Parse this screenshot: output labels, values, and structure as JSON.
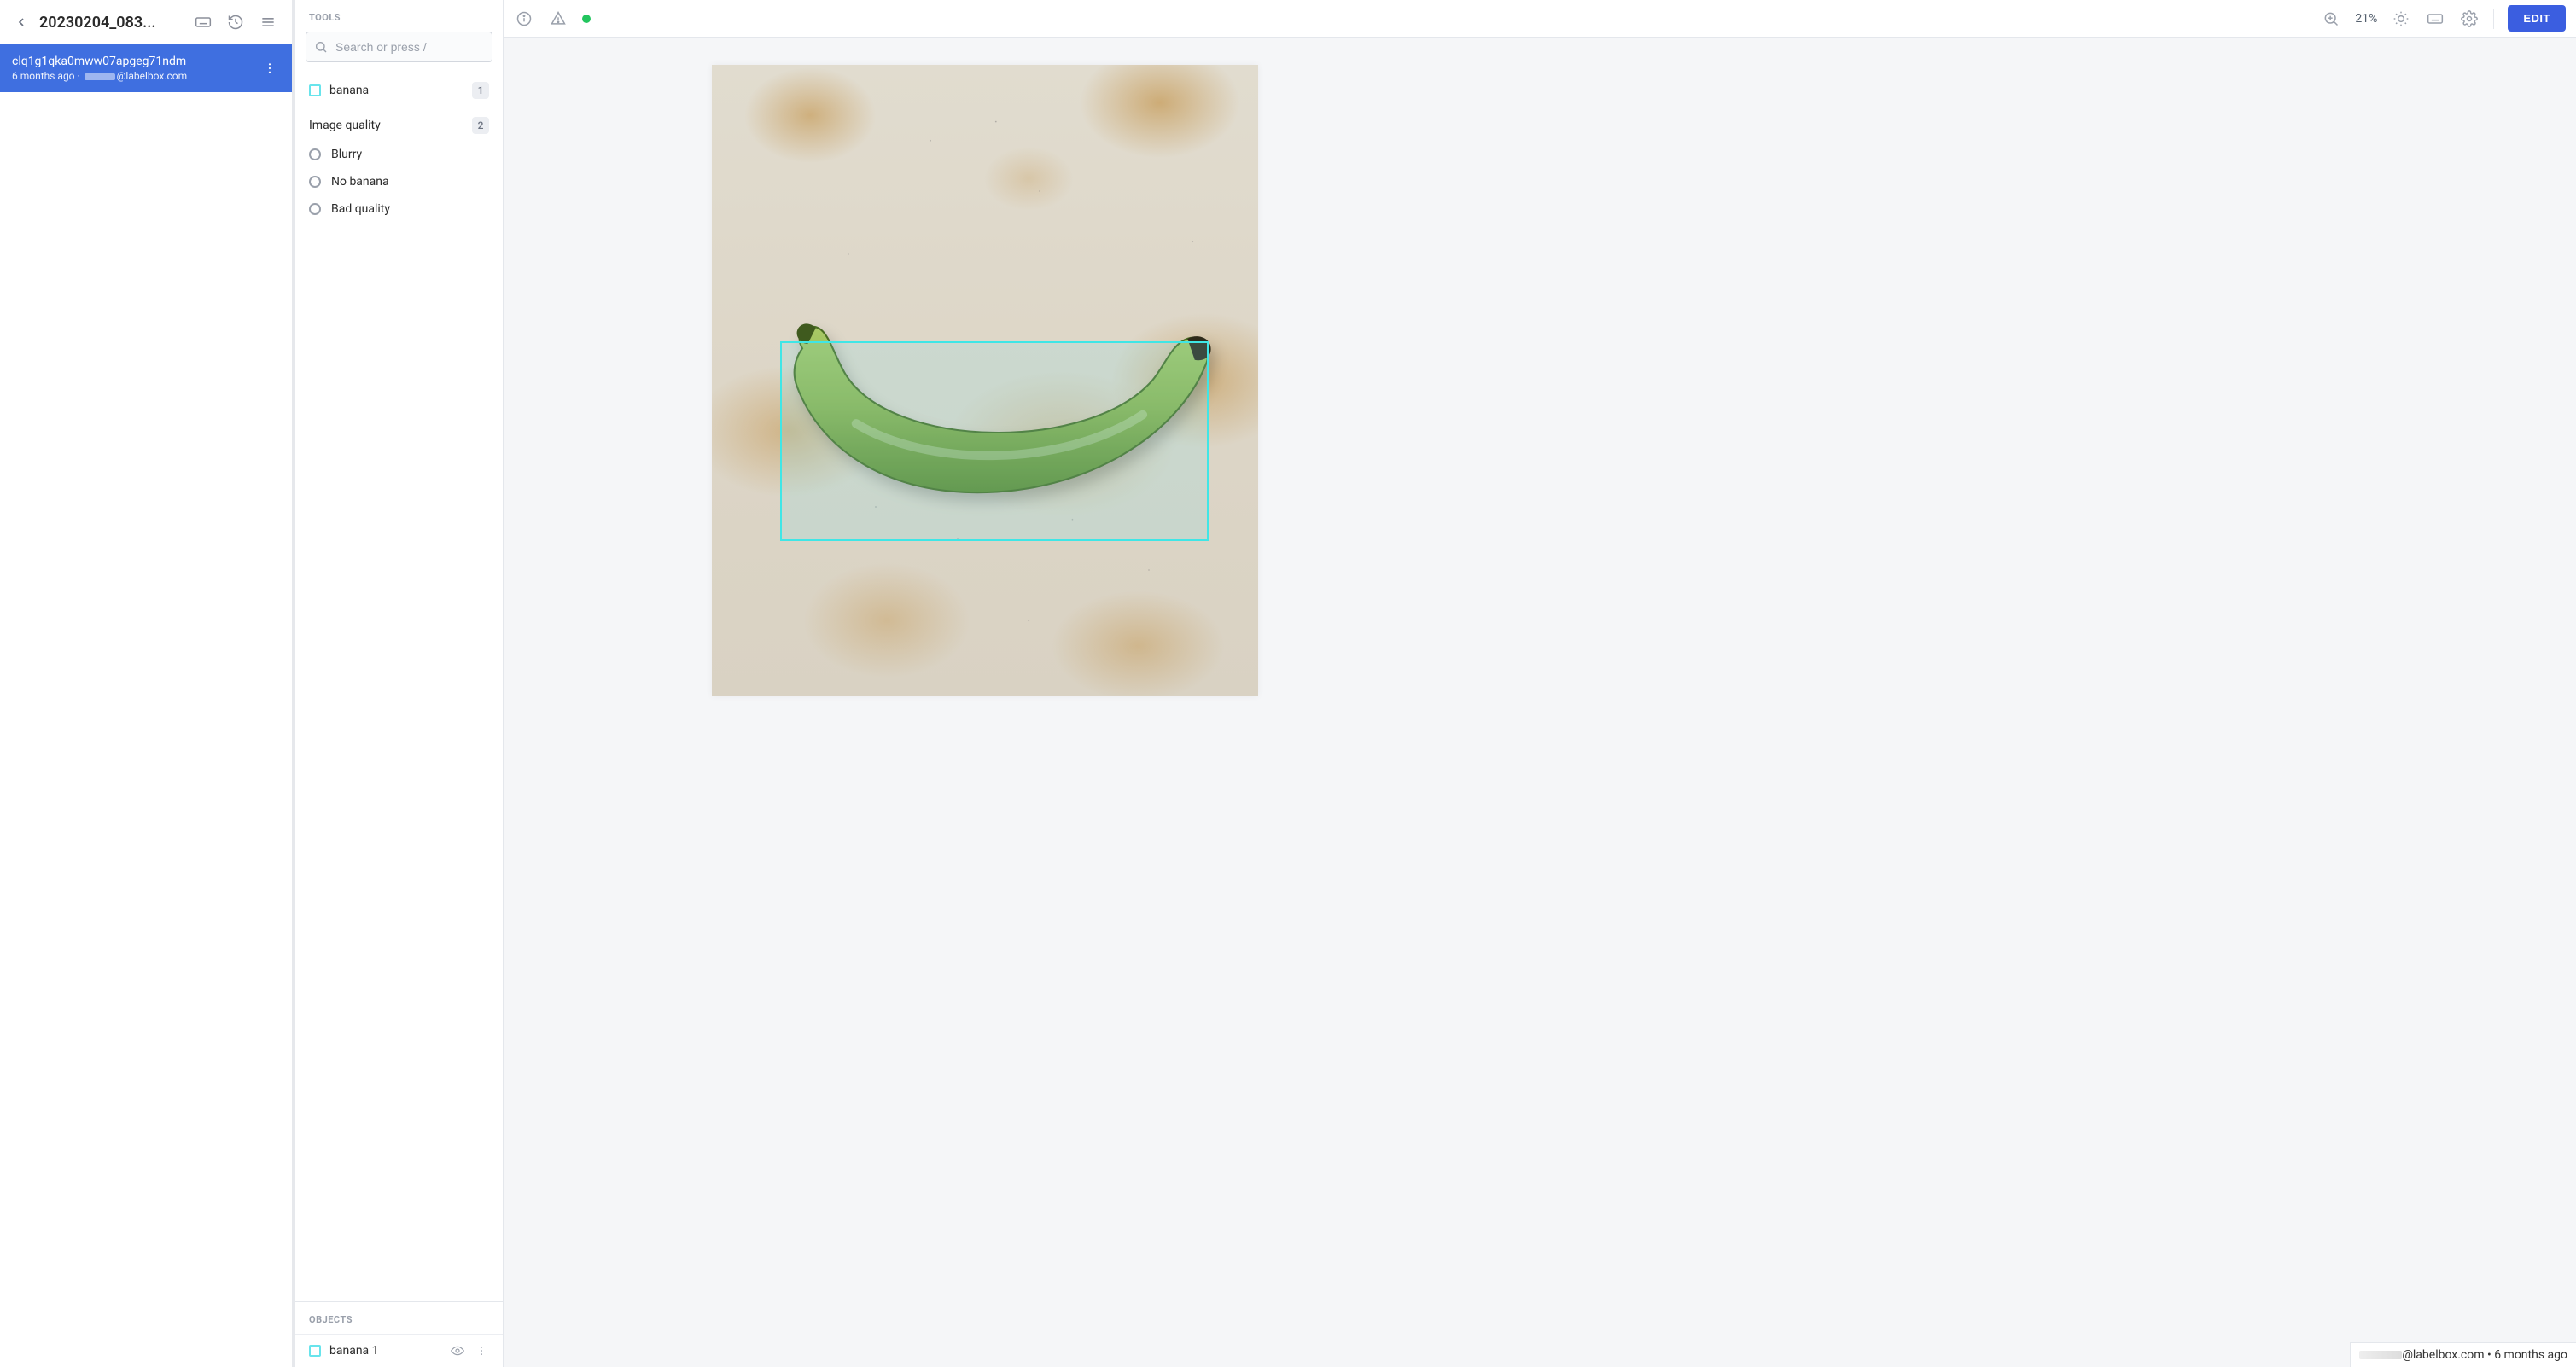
{
  "left_sidebar": {
    "title": "20230204_083...",
    "item": {
      "id": "clq1g1qka0mww07apgeg71ndm",
      "meta_time": "6 months ago",
      "meta_sep": " · ",
      "meta_user_suffix": "@labelbox.com"
    }
  },
  "tools_panel": {
    "header": "TOOLS",
    "search_placeholder": "Search or press /",
    "tool": {
      "name": "banana",
      "shortcut": "1",
      "swatch_color": "#68e4ec"
    },
    "classification": {
      "title": "Image quality",
      "shortcut": "2",
      "options": [
        "Blurry",
        "No banana",
        "Bad quality"
      ]
    },
    "objects_header": "OBJECTS",
    "objects": [
      {
        "name": "banana 1",
        "swatch_color": "#68e4ec"
      }
    ]
  },
  "topbar": {
    "zoom": "21%",
    "edit_label": "EDIT"
  },
  "footer": {
    "user_suffix": "@labelbox.com",
    "sep": " • ",
    "time": "6 months ago"
  }
}
